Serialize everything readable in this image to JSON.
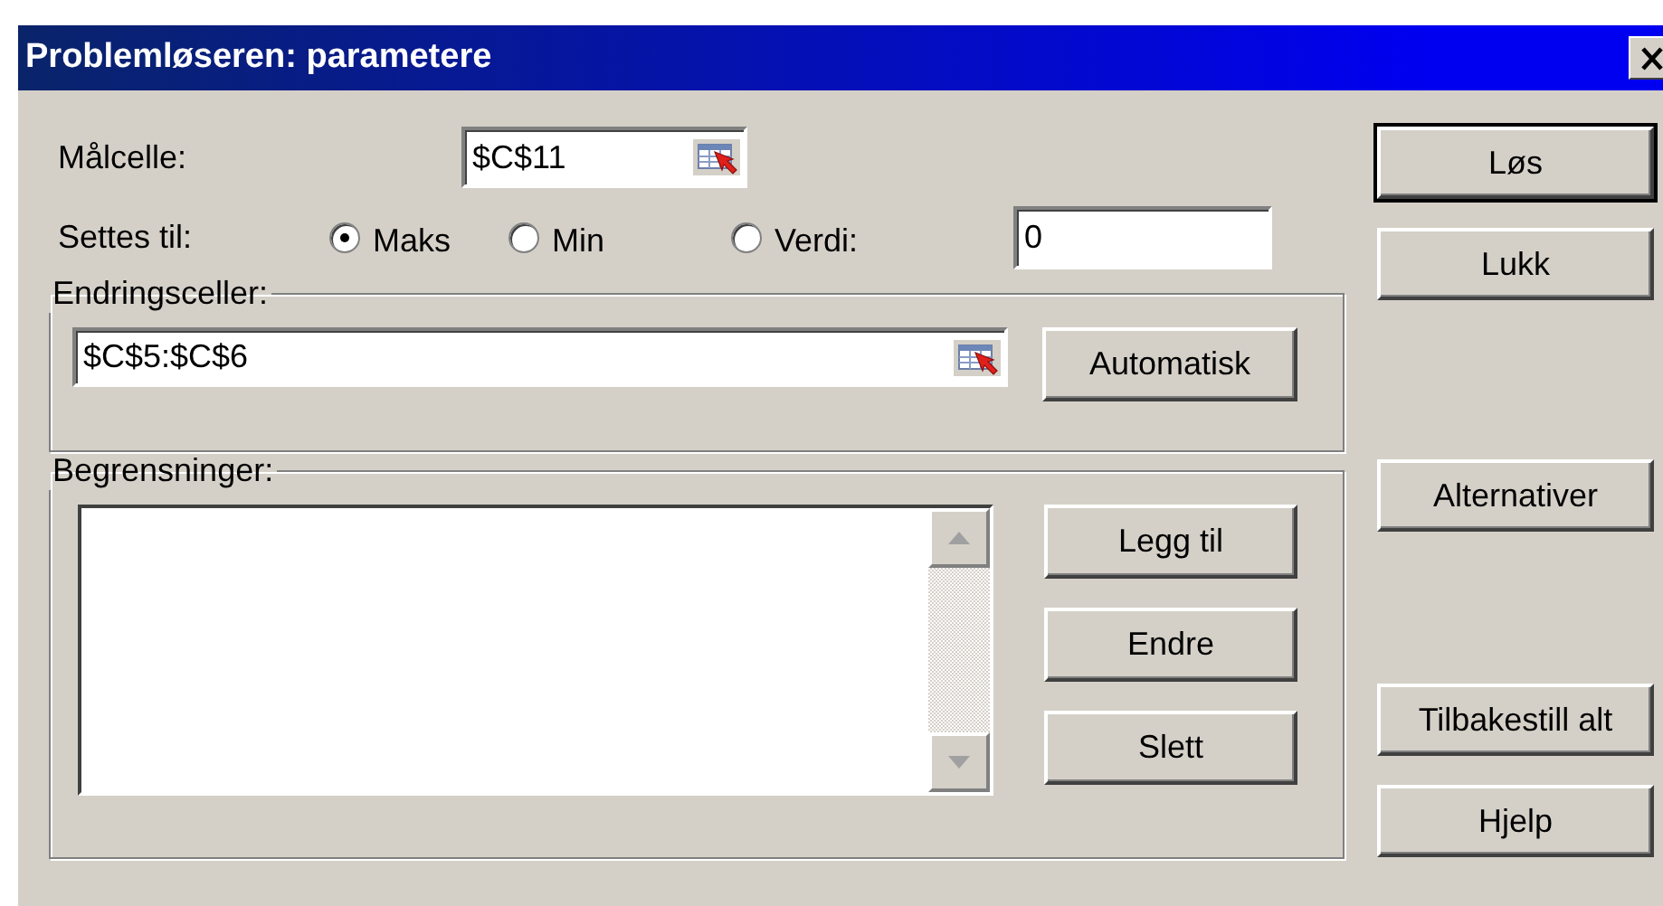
{
  "window": {
    "title": "Problemløseren: parametere"
  },
  "target_cell": {
    "label": "Målcelle:",
    "value": "$C$11"
  },
  "set_to": {
    "label": "Settes til:",
    "options": [
      {
        "label": "Maks",
        "selected": true
      },
      {
        "label": "Min",
        "selected": false
      },
      {
        "label": "Verdi:",
        "selected": false
      }
    ],
    "value": "0"
  },
  "changing_cells": {
    "legend": "Endringsceller:",
    "value": "$C$5:$C$6",
    "button": "Automatisk"
  },
  "constraints": {
    "legend": "Begrensninger:",
    "buttons": [
      "Legg til",
      "Endre",
      "Slett"
    ]
  },
  "side_buttons": [
    {
      "label": "Løs",
      "default": true
    },
    {
      "label": "Lukk",
      "default": false
    },
    {
      "label": "Alternativer",
      "default": false
    },
    {
      "label": "Tilbakestill alt",
      "default": false
    },
    {
      "label": "Hjelp",
      "default": false
    }
  ]
}
